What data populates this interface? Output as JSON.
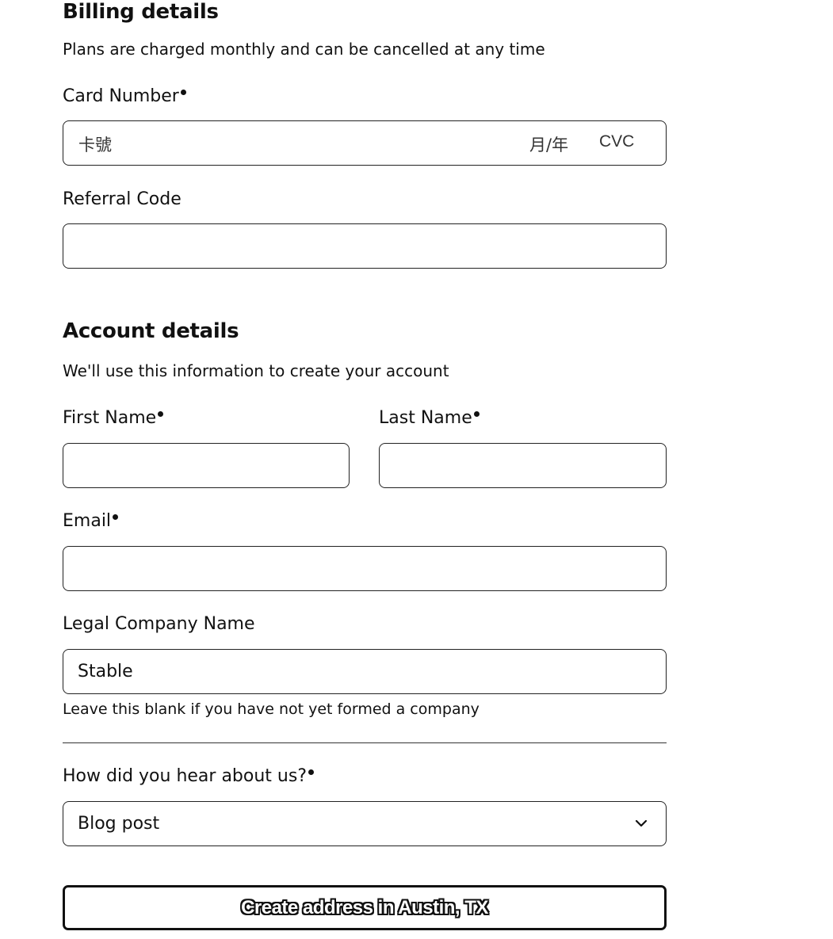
{
  "billing": {
    "title": "Billing details",
    "subtitle": "Plans are charged monthly and can be cancelled at any time",
    "card_label": "Card Number",
    "card_number_placeholder": "卡號",
    "card_expiry_placeholder": "月/年",
    "card_cvc_placeholder": "CVC",
    "referral_label": "Referral Code",
    "referral_value": ""
  },
  "account": {
    "title": "Account details",
    "subtitle": "We'll use this information to create your account",
    "first_name_label": "First Name",
    "first_name_value": "",
    "last_name_label": "Last Name",
    "last_name_value": "",
    "email_label": "Email",
    "email_value": "",
    "company_label": "Legal Company Name",
    "company_value": "Stable",
    "company_hint": "Leave this blank if you have not yet formed a company",
    "source_label": "How did you hear about us?",
    "source_selected": "Blog post",
    "submit_label": "Create address in Austin, TX"
  },
  "colors": {
    "text": "#111111",
    "border": "#222222",
    "background": "#ffffff"
  },
  "icons": {
    "select": "chevron-down-icon",
    "required": "required-dot-icon"
  }
}
